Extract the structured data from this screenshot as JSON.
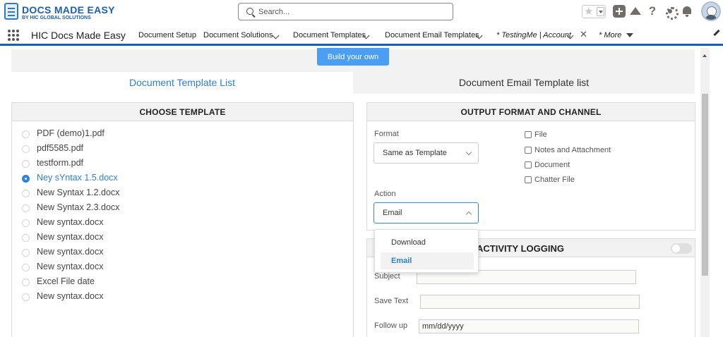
{
  "header": {
    "logo_title": "DOCS MADE EASY",
    "logo_subtitle": "BY HIC GLOBAL SOLUTIONS",
    "search_placeholder": "Search...",
    "help_glyph": "?"
  },
  "nav": {
    "app_name": "HIC Docs Made Easy",
    "items": [
      {
        "label": "Document Setup"
      },
      {
        "label": "Document Solutions"
      },
      {
        "label": "Document Templates"
      },
      {
        "label": "Document Email Templates"
      },
      {
        "label": "* TestingMe | Account"
      },
      {
        "label": "* More"
      }
    ],
    "close_glyph": "✕"
  },
  "content": {
    "build_button": "Build your own",
    "tabs": [
      {
        "label": "Document Template List",
        "active": true
      },
      {
        "label": "Document Email Template list",
        "active": false
      }
    ],
    "choose_template": {
      "title": "CHOOSE TEMPLATE",
      "selected_index": 3,
      "items": [
        "PDF (demo)1.pdf",
        "pdf5585.pdf",
        "testform.pdf",
        "Ney sYntax 1.5.docx",
        "New Syntax 1.2.docx",
        "New Syntax 2.3.docx",
        "New syntax.docx",
        "New syntax.docx",
        "New syntax.docx",
        "New syntax.docx",
        "Excel File date",
        "New syntax.docx"
      ]
    },
    "output": {
      "title": "OUTPUT FORMAT AND CHANNEL",
      "format_label": "Format",
      "format_value": "Same as Template",
      "action_label": "Action",
      "action_value": "Email",
      "action_options": [
        "Download",
        "Email"
      ],
      "channels": [
        "File",
        "Notes and Attachment",
        "Document",
        "Chatter File"
      ]
    },
    "activity": {
      "title_visible": "ACTIVITY LOGGING",
      "toggle_on": false,
      "subject_label": "Subject",
      "subject_value": "",
      "save_text_label": "Save Text",
      "save_text_value": "",
      "follow_up_label": "Follow up",
      "follow_up_value": "mm/dd/yyyy"
    }
  },
  "colors": {
    "brand_blue": "#1b5fa8",
    "accent_blue": "#2d7fd3",
    "button_blue": "#4a9ff5",
    "panel_header_bg": "#f3f2f2"
  }
}
